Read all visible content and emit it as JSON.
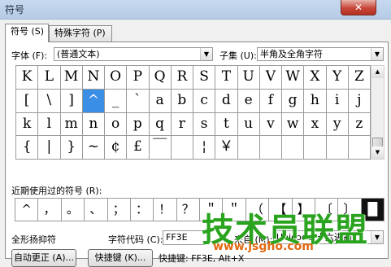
{
  "window": {
    "title": "符号",
    "close_glyph": "✕"
  },
  "tabs": [
    {
      "label": "符号 (S)"
    },
    {
      "label": "特殊字符 (P)"
    }
  ],
  "font": {
    "label": "字体 (F):",
    "value": "(普通文本)"
  },
  "subset": {
    "label": "子集 (U):",
    "value": "半角及全角字符"
  },
  "grid": {
    "rows": [
      [
        "K",
        "L",
        "M",
        "N",
        "O",
        "P",
        "Q",
        "R",
        "S",
        "T",
        "U",
        "V",
        "W",
        "X",
        "Y",
        "Z"
      ],
      [
        "[",
        "\\",
        "]",
        "^",
        "_",
        "`",
        "a",
        "b",
        "c",
        "d",
        "e",
        "f",
        "g",
        "h",
        "i",
        "j"
      ],
      [
        "k",
        "l",
        "m",
        "n",
        "o",
        "p",
        "q",
        "r",
        "s",
        "t",
        "u",
        "v",
        "w",
        "x",
        "y",
        "z"
      ],
      [
        "{",
        "|",
        "}",
        "~",
        "¢",
        "£",
        "￣",
        "",
        "¦",
        "￥",
        "",
        "",
        "",
        "",
        "",
        ""
      ]
    ],
    "selected": {
      "row": 1,
      "col": 3
    }
  },
  "recent": {
    "label": "近期使用过的符号 (R):",
    "symbols": [
      "^",
      "，",
      "。",
      "、",
      "；",
      "：",
      "！",
      "？",
      "＂",
      "＂",
      "（",
      "【",
      "】",
      "〔",
      "〕",
      "█"
    ]
  },
  "status": {
    "char_name": "全形扬抑符",
    "code_label": "字符代码 (C):",
    "code_value": "FF3E",
    "from_label": "来自 (M):",
    "from_value": "Unicode(十六进制)"
  },
  "buttons": {
    "autocorrect": "自动更正 (A)...",
    "shortcut_key": "快捷键 (K)...",
    "shortcut_text": "快捷键: FF3E, Alt+X"
  },
  "watermark": {
    "text": "技术员联盟",
    "url": "www.jsgho.com"
  }
}
